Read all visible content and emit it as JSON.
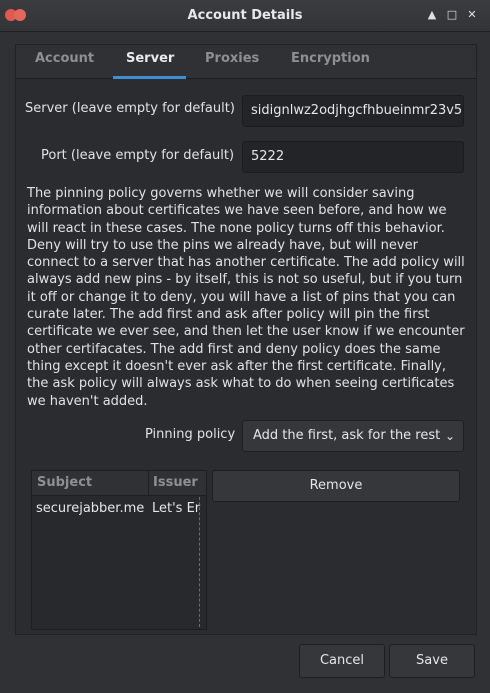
{
  "window": {
    "title": "Account Details",
    "controls": [
      "arrow-up-icon",
      "maximize-icon",
      "close-icon"
    ]
  },
  "tabs": [
    {
      "label": "Account",
      "active": false
    },
    {
      "label": "Server",
      "active": true
    },
    {
      "label": "Proxies",
      "active": false
    },
    {
      "label": "Encryption",
      "active": false
    }
  ],
  "server": {
    "label": "Server (leave empty for default)",
    "value": "sidignlwz2odjhgcfhbueinmr23v5"
  },
  "port": {
    "label": "Port (leave empty for default)",
    "value": "5222"
  },
  "description": "The pinning policy governs whether we will consider saving information about certificates we have seen before, and how we will react in these cases. The none policy turns off this behavior. Deny will try to use the pins we already have, but will never connect to a server that has another certificate. The add policy will always add new pins - by itself, this is not so useful, but if you turn it off or change it to deny, you will have a list of pins that you can curate later. The add first and ask after policy will pin the first certificate we ever see, and then let the user know if we encounter other certifacates. The add first and deny policy does the same thing except it doesn't ever ask after the first certificate. Finally, the ask policy will always ask what to do when seeing certificates we haven't added.",
  "pinning": {
    "label": "Pinning policy",
    "selected": "Add the first, ask for the rest"
  },
  "pins_table": {
    "columns": [
      "Subject",
      "Issuer"
    ],
    "rows": [
      {
        "subject": "securejabber.me",
        "issuer": "Let's Er"
      }
    ]
  },
  "buttons": {
    "remove": "Remove",
    "cancel": "Cancel",
    "save": "Save"
  },
  "colors": {
    "accent": "#3f8fd2",
    "close_button": "#e05a4f"
  }
}
